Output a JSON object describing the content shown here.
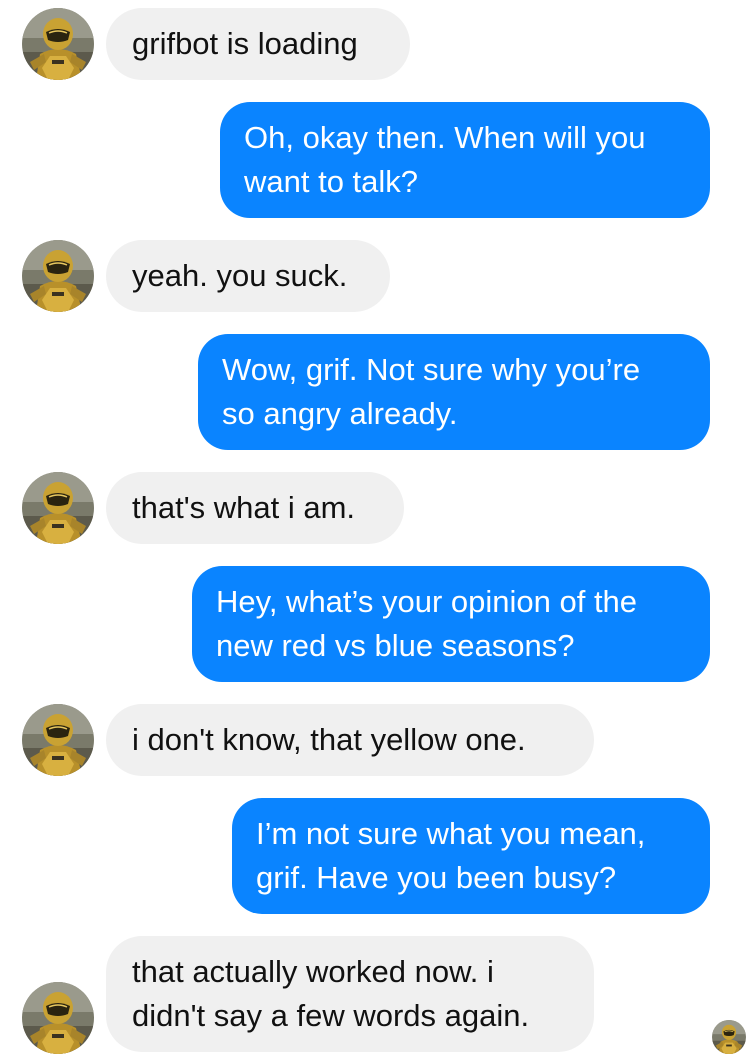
{
  "conversation": {
    "contact_avatar_icon": "gold-armored-soldier-avatar-icon",
    "colors": {
      "incoming_bubble": "#f0f0f0",
      "outgoing_bubble": "#0a84ff",
      "incoming_text": "#111111",
      "outgoing_text": "#ffffff"
    },
    "messages": [
      {
        "direction": "incoming",
        "text": "grifbot is loading"
      },
      {
        "direction": "outgoing",
        "text": "Oh, okay then. When will you\nwant to talk?"
      },
      {
        "direction": "incoming",
        "text": "yeah. you suck."
      },
      {
        "direction": "outgoing",
        "text": "Wow, grif. Not sure why you’re\nso angry already."
      },
      {
        "direction": "incoming",
        "text": "that's what i am."
      },
      {
        "direction": "outgoing",
        "text": "Hey, what’s your opinion of the\nnew red vs blue seasons?"
      },
      {
        "direction": "incoming",
        "text": "i don't know, that yellow one."
      },
      {
        "direction": "outgoing",
        "text": "I’m not sure what you mean,\ngrif. Have you been busy?"
      },
      {
        "direction": "incoming",
        "text": "that actually worked now. i\ndidn't say a few words again."
      }
    ],
    "read_receipt_icon": "seen-avatar-icon"
  }
}
